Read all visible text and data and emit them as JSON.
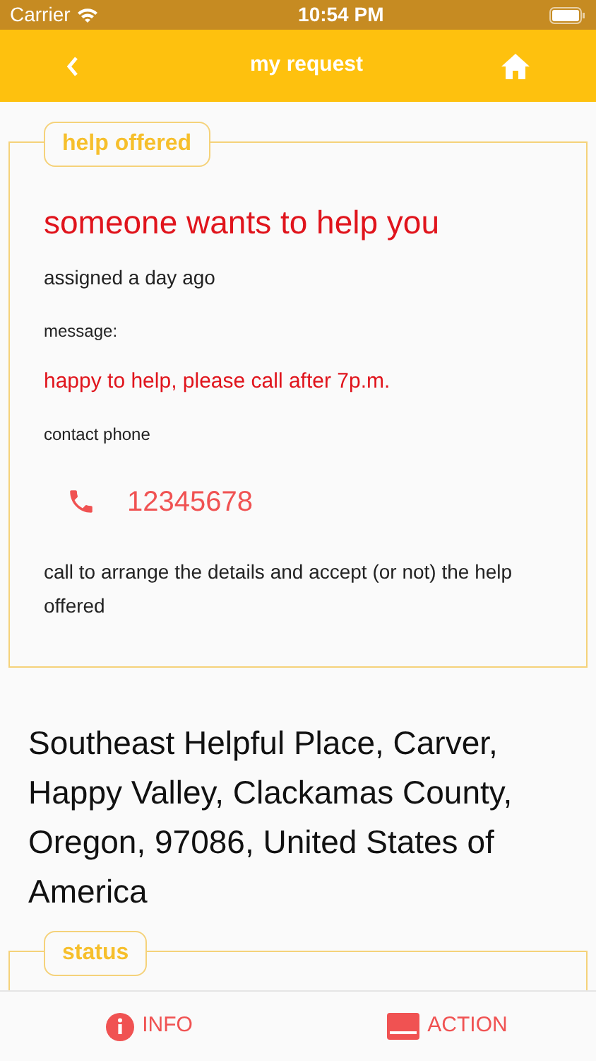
{
  "status_bar": {
    "carrier": "Carrier",
    "time": "10:54 PM"
  },
  "nav": {
    "title": "my request"
  },
  "help_card": {
    "legend": "help offered",
    "heading": "someone wants to help you",
    "assigned": "assigned a day ago",
    "message_label": "message:",
    "message": "happy to help, please call after 7p.m.",
    "phone_label": "contact phone",
    "phone": "12345678",
    "note": "call to arrange the details and accept (or not) the help offered"
  },
  "address": "Southeast Helpful Place, Carver, Happy Valley, Clackamas County, Oregon, 97086, United States of America",
  "status_card": {
    "legend": "status"
  },
  "bottom_tabs": [
    {
      "label": "INFO",
      "kind": "info"
    },
    {
      "label": "ACTION",
      "kind": "action"
    }
  ]
}
